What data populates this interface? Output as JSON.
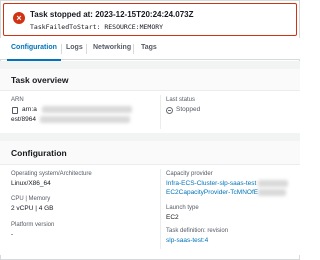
{
  "banner": {
    "title": "Task stopped at: 2023-12-15T20:24:24.073Z",
    "reason": "TaskFailedToStart: RESOURCE:MEMORY",
    "icon": "error-icon",
    "color": "#d13212"
  },
  "tabs": [
    {
      "label": "Configuration",
      "active": true
    },
    {
      "label": "Logs",
      "active": false
    },
    {
      "label": "Networking",
      "active": false
    },
    {
      "label": "Tags",
      "active": false
    }
  ],
  "overview": {
    "title": "Task overview",
    "arn_label": "ARN",
    "arn_line1": "arn:a",
    "arn_line2": "est/8964",
    "last_status_label": "Last status",
    "last_status_value": "Stopped"
  },
  "configuration": {
    "title": "Configuration",
    "os_label": "Operating system/Architecture",
    "os_value": "Linux/X86_64",
    "cpu_label": "CPU | Memory",
    "cpu_value": "2 vCPU | 4 GB",
    "platform_label": "Platform version",
    "platform_value": "-",
    "capacity_label": "Capacity provider",
    "capacity_line1": "Infra-ECS-Cluster-slp-saas-test",
    "capacity_line2": "EC2CapacityProvider-TcMNOfE",
    "launch_label": "Launch type",
    "launch_value": "EC2",
    "taskdef_label": "Task definition: revision",
    "taskdef_value": "slp-saas-test:4"
  },
  "colors": {
    "accent": "#0073bb",
    "error": "#d13212"
  }
}
